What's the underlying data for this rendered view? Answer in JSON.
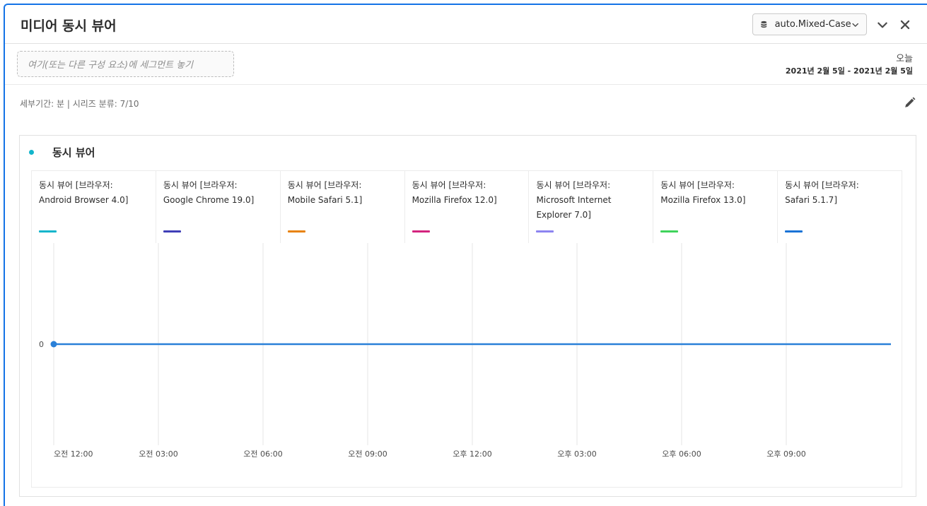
{
  "header": {
    "title": "미디어 동시 뷰어",
    "report_suite": "auto.Mixed-Case"
  },
  "segment": {
    "placeholder": "여기(또는 다른 구성 요소)에 세그먼트 놓기"
  },
  "date": {
    "label": "오늘",
    "range": "2021년 2월 5일 - 2021년 2월 5일"
  },
  "settings": {
    "summary": "세부기간: 분 | 시리즈 분류: 7/10"
  },
  "viz": {
    "title": "동시 뷰어",
    "accent_color": "#12b5cb"
  },
  "legend": [
    {
      "line1": "동시 뷰어 [브라우저:",
      "line2": "Android Browser 4.0]",
      "color": "#12b5cb"
    },
    {
      "line1": "동시 뷰어 [브라우저:",
      "line2": "Google Chrome 19.0]",
      "color": "#403fb7"
    },
    {
      "line1": "동시 뷰어 [브라우저:",
      "line2": "Mobile Safari 5.1]",
      "color": "#e8820c"
    },
    {
      "line1": "동시 뷰어 [브라우저:",
      "line2": "Mozilla Firefox 12.0]",
      "color": "#d3247e"
    },
    {
      "line1": "동시 뷰어 [브라우저:",
      "line2": "Microsoft Internet Explorer 7.0]",
      "color": "#8c84f0"
    },
    {
      "line1": "동시 뷰어 [브라우저:",
      "line2": "Mozilla Firefox 13.0]",
      "color": "#3fd35b"
    },
    {
      "line1": "동시 뷰어 [브라우저:",
      "line2": "Safari 5.1.7]",
      "color": "#1a73d6"
    }
  ],
  "chart_data": {
    "type": "line",
    "x": [
      "오전 12:00",
      "오전 03:00",
      "오전 06:00",
      "오전 09:00",
      "오후 12:00",
      "오후 03:00",
      "오후 06:00",
      "오후 09:00"
    ],
    "x_tick_labels": [
      "오전 12:00",
      "오전 03:00",
      "오전 06:00",
      "오전 09:00",
      "오후 12:00",
      "오후 03:00",
      "오후 06:00",
      "오후 09:00"
    ],
    "y_tick_labels": [
      "0"
    ],
    "x_range": [
      0,
      24
    ],
    "ylim": [
      -1,
      1
    ],
    "grid": "vertical",
    "series": [
      {
        "name": "동시 뷰어 [브라우저: Safari 5.1.7]",
        "color": "#2a80d8",
        "x": [
          0,
          24
        ],
        "values": [
          0,
          0
        ]
      }
    ]
  }
}
